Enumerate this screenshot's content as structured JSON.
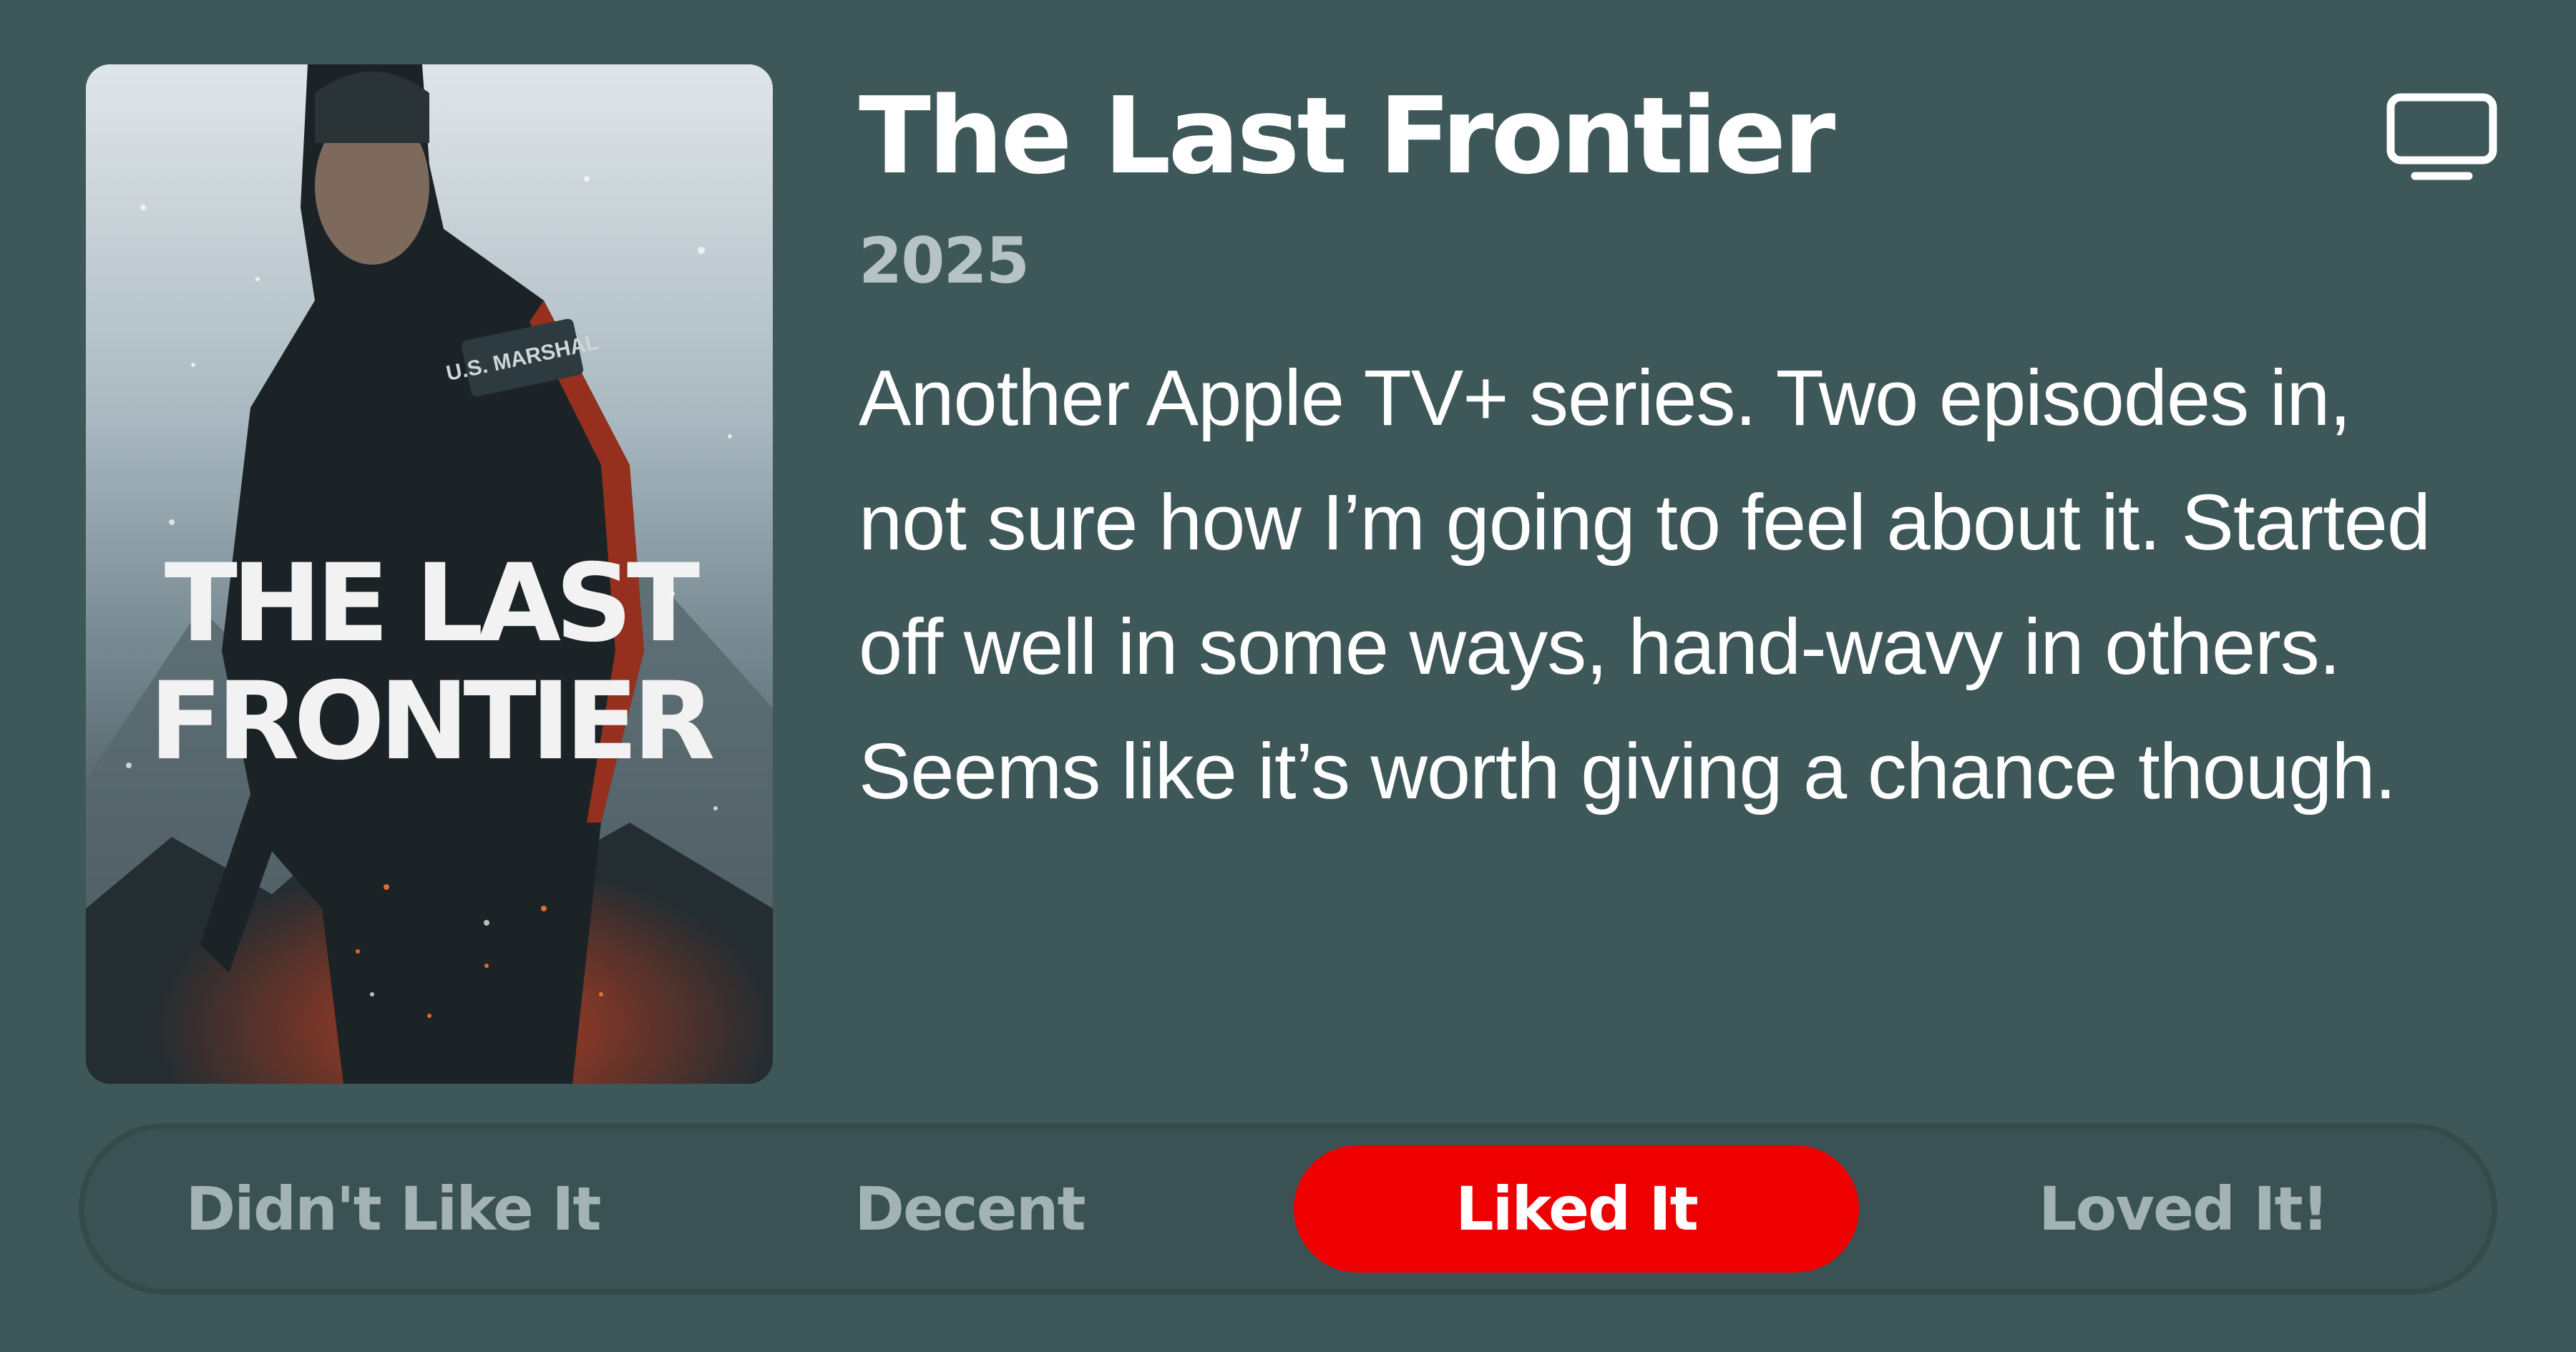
{
  "show": {
    "title": "The Last Frontier",
    "year": "2025",
    "review": "Another Apple TV+ series. Two episodes in, not sure how I’m going to feel about it. Started off well in some ways, hand-wavy in others. Seems like it’s worth giving a chance though.",
    "media_type_icon": "tv-icon"
  },
  "poster": {
    "title_line1": "THE LAST",
    "title_line2": "FRONTIER",
    "patch_text": "U.S. MARSHAL"
  },
  "rating": {
    "options": [
      {
        "label": "Didn't Like It",
        "selected": false
      },
      {
        "label": "Decent",
        "selected": false
      },
      {
        "label": "Liked It",
        "selected": true
      },
      {
        "label": "Loved It!",
        "selected": false
      }
    ],
    "selected_label": "Liked It",
    "accent_color": "#ee0000"
  },
  "colors": {
    "background": "#3e5758",
    "secondary_text": "#b5c3c4",
    "inactive_option_text": "#a3b3b4"
  }
}
